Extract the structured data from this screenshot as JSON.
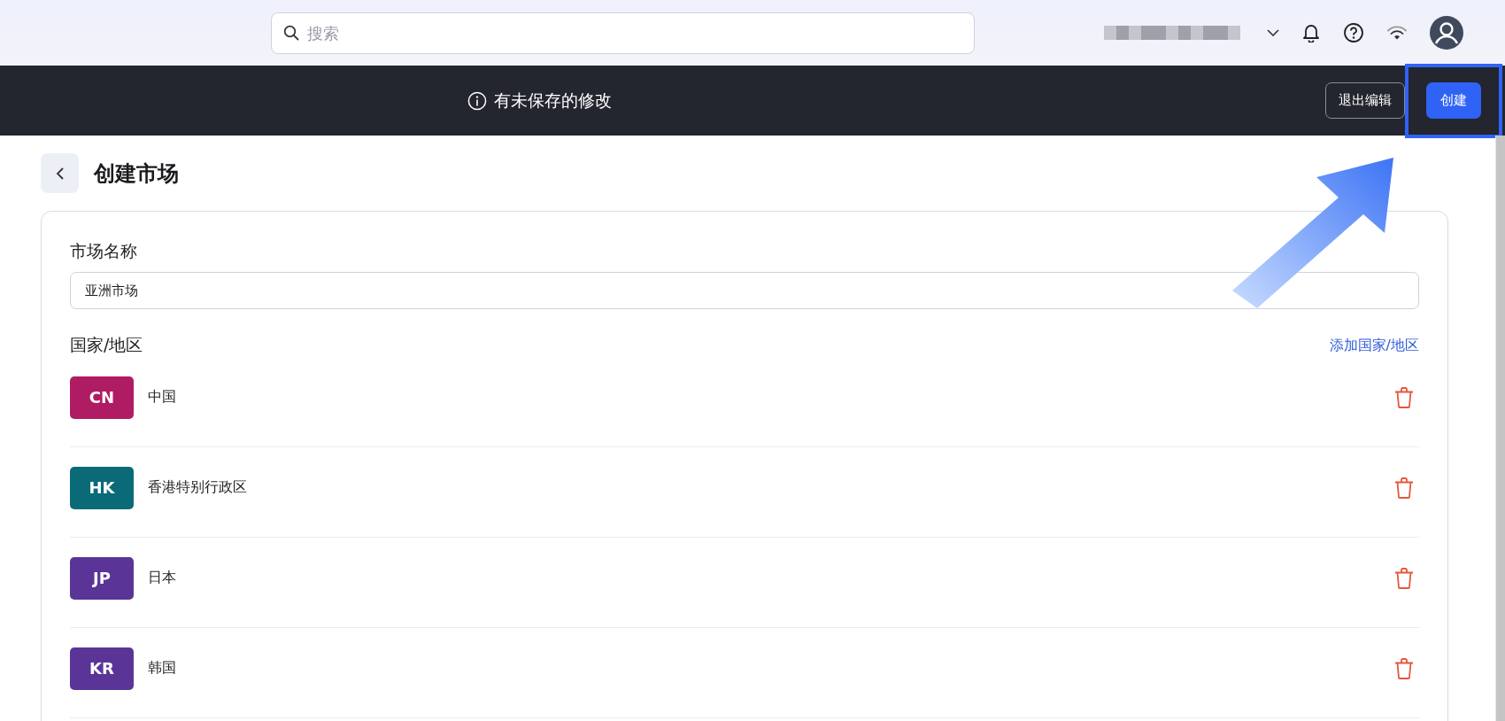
{
  "top_bar": {
    "search": {
      "placeholder": "搜索"
    }
  },
  "edit_bar": {
    "message": "有未保存的修改",
    "buttons": [
      {
        "label": "退出编辑",
        "kind": "outline",
        "highlighted": false
      },
      {
        "label": "创建",
        "kind": "primary",
        "highlighted": true
      }
    ]
  },
  "page": {
    "title": "创建市场"
  },
  "form": {
    "name_label": "市场名称",
    "name_value": "亚洲市场",
    "countries_label": "国家/地区",
    "add_link": "添加国家/地区",
    "countries": [
      {
        "code": "CN",
        "name": "中国",
        "color": "#b01c63"
      },
      {
        "code": "HK",
        "name": "香港特别行政区",
        "color": "#0b6a78"
      },
      {
        "code": "JP",
        "name": "日本",
        "color": "#5a3597"
      },
      {
        "code": "KR",
        "name": "韩国",
        "color": "#5a3597"
      }
    ]
  }
}
